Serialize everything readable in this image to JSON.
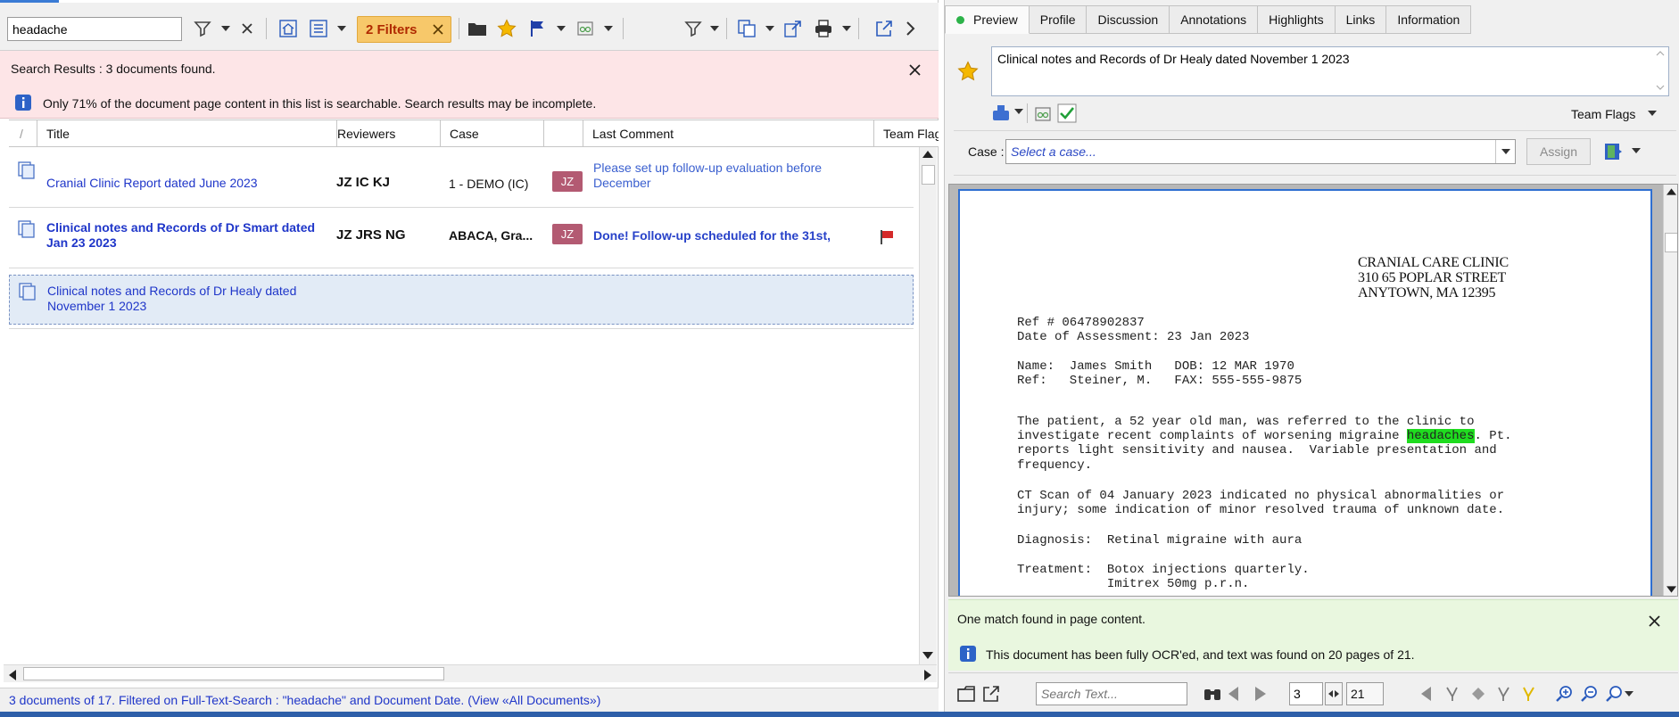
{
  "toolbar": {
    "search_value": "headache",
    "filters_chip_label": "2 Filters"
  },
  "banner": {
    "title": "Search Results : 3 documents found.",
    "info": "Only 71% of the document page content in this list is searchable.  Search results may be incomplete."
  },
  "grid": {
    "columns": [
      "/",
      "Title",
      "Reviewers",
      "Case",
      "Last Comment",
      "Team Flag"
    ],
    "rows": [
      {
        "title": "Cranial Clinic  Report dated June 2023",
        "reviewers": "JZ IC KJ",
        "case": "1 - DEMO (IC)",
        "comment_author": "JZ",
        "comment": "Please set up follow-up evaluation before December",
        "bold": false,
        "flag": false
      },
      {
        "title": "Clinical notes and Records of Dr Smart dated Jan 23 2023",
        "reviewers": "JZ JRS NG",
        "case": "ABACA, Gra...",
        "comment_author": "JZ",
        "comment": "Done!  Follow-up scheduled for the 31st,",
        "bold": true,
        "flag": true
      },
      {
        "title": "Clinical notes and Records of Dr Healy dated November 1 2023",
        "reviewers": "",
        "case": "",
        "comment_author": "",
        "comment": "",
        "bold": false,
        "flag": false
      }
    ]
  },
  "status_bar": {
    "text": "3 documents of 17.  Filtered on Full-Text-Search : \"headache\" and Document Date.",
    "link": "(View «All Documents»)"
  },
  "preview": {
    "tabs": [
      "Preview",
      "Profile",
      "Discussion",
      "Annotations",
      "Highlights",
      "Links",
      "Information"
    ],
    "active_tab": "Preview",
    "summary": "Clinical notes and Records of Dr Healy dated November 1 2023",
    "team_flags_label": "Team Flags",
    "case_label": "Case :",
    "case_placeholder": "Select a case...",
    "assign_label": "Assign"
  },
  "document": {
    "clinic_name": "CRANIAL CARE CLINIC",
    "clinic_street": "310 65 POPLAR STREET",
    "clinic_city": "ANYTOWN, MA 12395",
    "ref": "Ref # 06478902837",
    "date": "Date of Assessment: 23 Jan 2023",
    "name_line": "Name:  James Smith   DOB: 12 MAR 1970",
    "ref_line": "Ref:   Steiner, M.   FAX: 555-555-9875",
    "para1_a": "The patient, a 52 year old man, was referred to the clinic to",
    "para1_b_pre": "investigate recent complaints of worsening migraine ",
    "para1_b_hl": "headaches",
    "para1_b_post": ". Pt.",
    "para1_c": "reports light sensitivity and nausea.  Variable presentation and",
    "para1_d": "frequency.",
    "para2_a": "CT Scan of 04 January 2023 indicated no physical abnormalities or",
    "para2_b": "injury; some indication of minor resolved trauma of unknown date.",
    "diagnosis": "Diagnosis:  Retinal migraine with aura",
    "treatment_a": "Treatment:  Botox injections quarterly.",
    "treatment_b": "            Imitrex 50mg p.r.n."
  },
  "match_bar": {
    "message": "One match found in page content.",
    "ocr_info": "This document has been fully OCR'ed, and text was found on 20 pages of 21."
  },
  "bottom_bar": {
    "search_placeholder": "Search Text...",
    "page_current": "3",
    "page_total": "21"
  },
  "colors": {
    "banner_bg": "#fde5e7",
    "filter_chip": "#f7c86a",
    "link_blue": "#1f36c9",
    "badge": "#b35a72",
    "highlight": "#1fdc1f",
    "match_bg": "#e9f7df",
    "page_border": "#2f6fd1"
  },
  "icons": [
    "filter-icon",
    "clear-icon",
    "home-icon",
    "list-icon",
    "folder-icon",
    "star-icon",
    "flag-icon",
    "glasses-icon",
    "copy-icon",
    "export-icon",
    "print-icon",
    "open-external-icon",
    "chevron-right-icon",
    "info-icon",
    "document-icon",
    "check-icon",
    "binoculars-icon",
    "zoom-icon"
  ]
}
